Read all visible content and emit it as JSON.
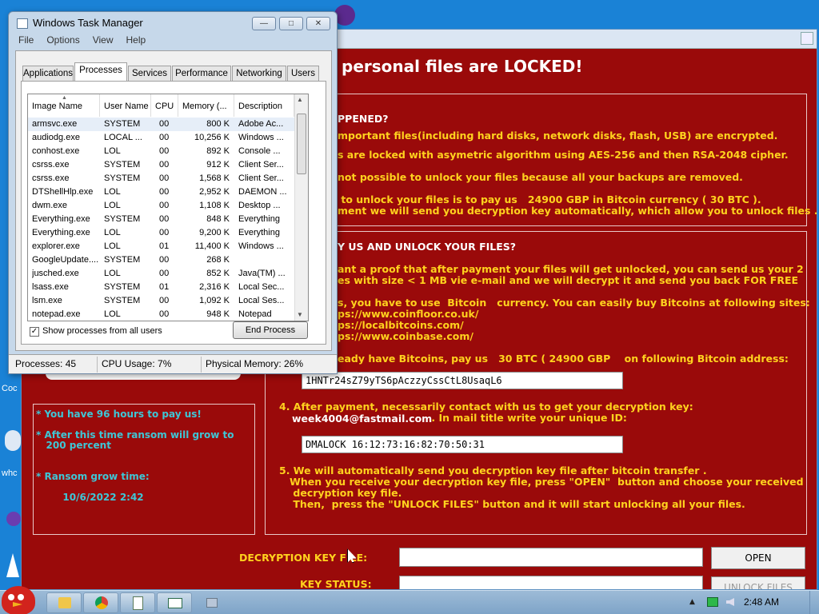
{
  "desktop": {
    "icon_labels": [
      "Coc",
      "whc"
    ]
  },
  "ransom": {
    "title": "personal files are LOCKED!",
    "section1_heading": "PPENED?",
    "section1_lines": [
      "mportant files(including hard disks, network disks, flash, USB) are encrypted.",
      "s are locked with asymetric algorithm using AES-256 and then RSA-2048 cipher.",
      "not possible to unlock your files because all your backups are removed.",
      " to unlock your files is to pay us   24900 GBP in Bitcoin currency ( 30 BTC ).",
      "ment we will send you decryption key automatically, which allow you to unlock files ."
    ],
    "section2_heading": "Y US AND UNLOCK YOUR FILES?",
    "section2_lines": [
      "ant a proof that after payment your files will get unlocked, you can send us your 2",
      "es with size < 1 MB vie e-mail and we will decrypt it and send you back FOR FREE",
      "s, you have to use  Bitcoin   currency. You can easily buy Bitcoins at following sites:",
      "ps://www.coinfloor.co.uk/",
      "ps://localbitcoins.com/",
      "ps://www.coinbase.com/",
      "eady have Bitcoins, pay us   30 BTC ( 24900 GBP    on following Bitcoin address:"
    ],
    "bitcoin_address": "1HNTr24sZ79yTS6pAczzyCssCtL8UsaqL6",
    "step4_line1": "4. After payment, necessarily contact with us to get your decryption key:",
    "step4_email": "week4004@fastmail.com",
    "step4_line2": " . In mail title write your unique ID:",
    "unique_id": "DMALOCK 16:12:73:16:82:70:50:31",
    "step5_lines": [
      "5. We will automatically send you decryption key file after bitcoin transfer .",
      "   When you receive your decryption key file, press \"OPEN\"  button and choose your received",
      "    decryption key file.",
      "    Then,  press the \"UNLOCK FILES\" button and it will start unlocking all your files."
    ],
    "timer_lines": [
      "* You have 96 hours to pay us!",
      "* After this time ransom will grow to",
      "   200 percent",
      "* Ransom grow time:",
      "        10/6/2022 2:42"
    ],
    "decryption_key_label": "DECRYPTION KEY FILE:",
    "key_status_label": "KEY STATUS:",
    "open_button": "OPEN",
    "unlock_button": "UNLOCK FILES"
  },
  "task_manager": {
    "title": "Windows Task Manager",
    "menu": [
      "File",
      "Options",
      "View",
      "Help"
    ],
    "tabs": [
      "Applications",
      "Processes",
      "Services",
      "Performance",
      "Networking",
      "Users"
    ],
    "active_tab": "Processes",
    "columns": [
      "Image Name",
      "User Name",
      "CPU",
      "Memory (...",
      "Description"
    ],
    "processes": [
      {
        "name": "armsvc.exe",
        "user": "SYSTEM",
        "cpu": "00",
        "mem": "800 K",
        "desc": "Adobe Ac..."
      },
      {
        "name": "audiodg.exe",
        "user": "LOCAL ...",
        "cpu": "00",
        "mem": "10,256 K",
        "desc": "Windows ..."
      },
      {
        "name": "conhost.exe",
        "user": "LOL",
        "cpu": "00",
        "mem": "892 K",
        "desc": "Console ..."
      },
      {
        "name": "csrss.exe",
        "user": "SYSTEM",
        "cpu": "00",
        "mem": "912 K",
        "desc": "Client Ser..."
      },
      {
        "name": "csrss.exe",
        "user": "SYSTEM",
        "cpu": "00",
        "mem": "1,568 K",
        "desc": "Client Ser..."
      },
      {
        "name": "DTShellHlp.exe",
        "user": "LOL",
        "cpu": "00",
        "mem": "2,952 K",
        "desc": "DAEMON ..."
      },
      {
        "name": "dwm.exe",
        "user": "LOL",
        "cpu": "00",
        "mem": "1,108 K",
        "desc": "Desktop ..."
      },
      {
        "name": "Everything.exe",
        "user": "SYSTEM",
        "cpu": "00",
        "mem": "848 K",
        "desc": "Everything"
      },
      {
        "name": "Everything.exe",
        "user": "LOL",
        "cpu": "00",
        "mem": "9,200 K",
        "desc": "Everything"
      },
      {
        "name": "explorer.exe",
        "user": "LOL",
        "cpu": "01",
        "mem": "11,400 K",
        "desc": "Windows ..."
      },
      {
        "name": "GoogleUpdate....",
        "user": "SYSTEM",
        "cpu": "00",
        "mem": "268 K",
        "desc": ""
      },
      {
        "name": "jusched.exe",
        "user": "LOL",
        "cpu": "00",
        "mem": "852 K",
        "desc": "Java(TM) ..."
      },
      {
        "name": "lsass.exe",
        "user": "SYSTEM",
        "cpu": "01",
        "mem": "2,316 K",
        "desc": "Local Sec..."
      },
      {
        "name": "lsm.exe",
        "user": "SYSTEM",
        "cpu": "00",
        "mem": "1,092 K",
        "desc": "Local Ses..."
      },
      {
        "name": "notepad.exe",
        "user": "LOL",
        "cpu": "00",
        "mem": "948 K",
        "desc": "Notepad"
      }
    ],
    "show_all_label": "Show processes from all users",
    "show_all_checked": true,
    "end_process_label": "End Process",
    "status": {
      "processes": "Processes: 45",
      "cpu": "CPU Usage: 7%",
      "memory": "Physical Memory: 26%"
    }
  },
  "taskbar": {
    "clock": "2:48 AM"
  }
}
